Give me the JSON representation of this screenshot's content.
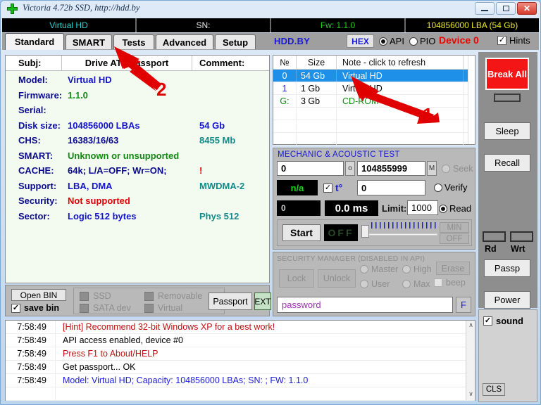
{
  "window": {
    "title": "Victoria 4.72b SSD, http://hdd.by",
    "icon": "green-cross-icon",
    "buttons": {
      "minimize": "minimize-icon",
      "maximize": "maximize-icon",
      "close": "✕"
    }
  },
  "infobar": {
    "model": "Virtual HD",
    "sn": "SN:",
    "fw": "Fw: 1.1.0",
    "lba": "104856000 LBA (54 Gb)"
  },
  "tabs": [
    {
      "label": "Standard",
      "active": true
    },
    {
      "label": "SMART",
      "active": false
    },
    {
      "label": "Tests",
      "active": false
    },
    {
      "label": "Advanced",
      "active": false
    },
    {
      "label": "Setup",
      "active": false
    }
  ],
  "toolbar": {
    "brand": "HDD.BY",
    "hex_label": "HEX",
    "api_label": "API",
    "pio_label": "PIO",
    "device_label": "Device 0",
    "hints_label": "Hints",
    "hints_checked": "✓",
    "api_selected": true
  },
  "passport": {
    "headers": {
      "subj": "Subj:",
      "title": "Drive ATA passport",
      "comment": "Comment:"
    },
    "rows": [
      {
        "key": "Model:",
        "value": "Virtual HD",
        "comment": ""
      },
      {
        "key": "Firmware:",
        "value": "1.1.0",
        "comment": ""
      },
      {
        "key": "Serial:",
        "value": "",
        "comment": ""
      },
      {
        "key": "Disk size:",
        "value": "104856000 LBAs",
        "comment": "54 Gb"
      },
      {
        "key": "CHS:",
        "value": "16383/16/63",
        "comment": "8455 Mb"
      },
      {
        "key": "SMART:",
        "value": "Unknown or unsupported",
        "comment": ""
      },
      {
        "key": "CACHE:",
        "value": "64k; L/A=OFF; Wr=ON;",
        "comment": "!"
      },
      {
        "key": "Support:",
        "value": "LBA, DMA",
        "comment": "MWDMA-2"
      },
      {
        "key": "Security:",
        "value": "Not supported",
        "comment": ""
      },
      {
        "key": "Sector:",
        "value": "Logic 512 bytes",
        "comment": "Phys 512"
      }
    ]
  },
  "left_bottom": {
    "open_bin": "Open BIN",
    "save_bin": "save bin",
    "save_bin_checked": "✓",
    "flags": [
      "SSD",
      "Removable",
      "SATA dev",
      "Virtual"
    ],
    "passport_button": "Passport",
    "ext_button": "EXT"
  },
  "drive_list": {
    "headers": [
      "№",
      "Size",
      "Note - click to refresh"
    ],
    "rows": [
      {
        "no": "0",
        "size": "54 Gb",
        "note": "Virtual HD",
        "selected": true
      },
      {
        "no": "1",
        "size": "1 Gb",
        "note": "Virtual HD",
        "selected": false
      },
      {
        "no": "G:",
        "size": "3 Gb",
        "note": "CD-ROM",
        "selected": false
      }
    ]
  },
  "mechanic": {
    "title": "MECHANIC  &  ACOUSTIC TEST",
    "start_lba": "0",
    "start_unit": "o",
    "end_lba": "104855999",
    "end_unit": "M",
    "temp_value": "n/a",
    "temp_label": "t°",
    "temp_checked": "✓",
    "block_value": "0",
    "counter": "0",
    "time_value": "0.0 ms",
    "limit_label": "Limit:",
    "limit_value": "1000",
    "modes": [
      {
        "label": "Seek",
        "selected": false,
        "disabled": true
      },
      {
        "label": "Verify",
        "selected": false,
        "disabled": false
      },
      {
        "label": "Read",
        "selected": true,
        "disabled": false
      }
    ],
    "start_button": "Start",
    "off_display": "OFF",
    "min_button": "MIN",
    "off_button": "OFF"
  },
  "security": {
    "title": "SECURITY MANAGER (DISABLED IN API)",
    "lock_button": "Lock",
    "unlock_button": "Unlock",
    "radios": [
      "Master",
      "High",
      "User",
      "Max"
    ],
    "erase_button": "Erase",
    "beep_label": "beep",
    "password_value": "password",
    "f_button": "F"
  },
  "sidebar": {
    "break_all": "Break All",
    "sleep": "Sleep",
    "recall": "Recall",
    "passp": "Passp",
    "power": "Power",
    "rd_label": "Rd",
    "wrt_label": "Wrt",
    "sound_label": "sound",
    "sound_checked": "✓",
    "cls_button": "CLS"
  },
  "log": {
    "entries": [
      {
        "time": "7:58:49",
        "msg": "[Hint] Recommend 32-bit Windows XP for a best work!",
        "color": "red"
      },
      {
        "time": "7:58:49",
        "msg": "API access enabled, device #0",
        "color": "black"
      },
      {
        "time": "7:58:49",
        "msg": "Press F1 to About/HELP",
        "color": "red"
      },
      {
        "time": "7:58:49",
        "msg": "Get passport... OK",
        "color": "black"
      },
      {
        "time": "7:58:49",
        "msg": "Model: Virtual HD; Capacity: 104856000 LBAs; SN:  ; FW: 1.1.0",
        "color": "blue"
      }
    ],
    "scroll_up": "∧",
    "scroll_down": "∨"
  },
  "annotations": [
    {
      "label": "1",
      "target": "drive-list-selected-row"
    },
    {
      "label": "2",
      "target": "tests-tab"
    }
  ],
  "colors": {
    "accent_red": "#e00000",
    "selection_blue": "#1e90e8",
    "brand_blue": "#1a1ad8",
    "panel_gray": "#b9b9b9"
  }
}
